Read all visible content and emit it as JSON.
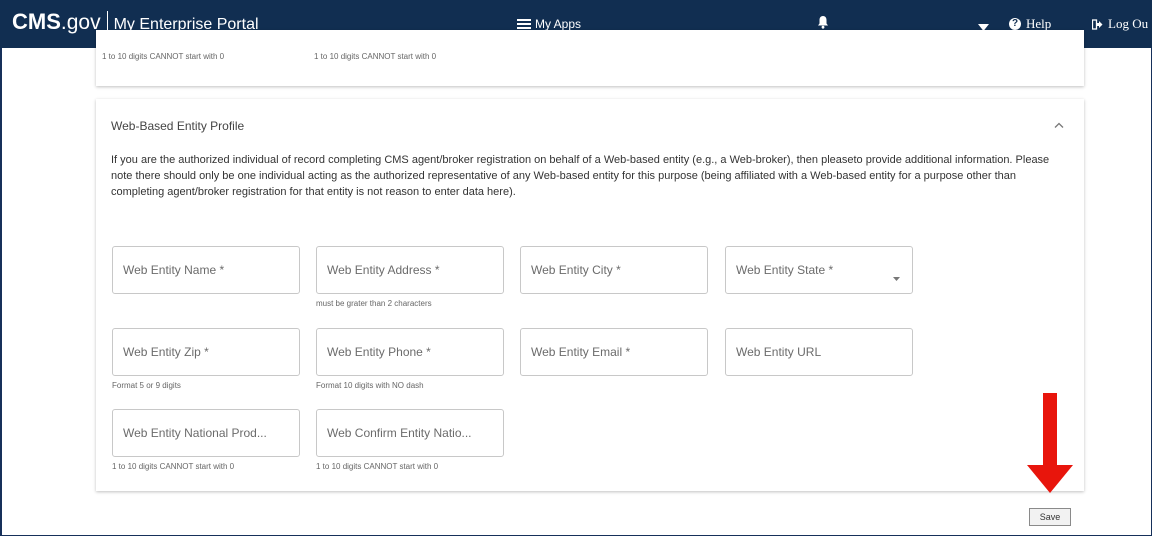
{
  "navbar": {
    "brand_cms": "CMS",
    "brand_gov": ".gov",
    "portal_title": "My Enterprise Portal",
    "apps_label": "My Apps",
    "help_label": "Help",
    "logout_label": "Log Ou"
  },
  "previous_card": {
    "hint_1": "1 to 10 digits CANNOT start with 0",
    "hint_2": "1 to 10 digits CANNOT start with 0"
  },
  "section": {
    "title": "Web-Based Entity Profile",
    "description": "If you are the authorized individual of record completing CMS agent/broker registration on behalf of a Web-based entity (e.g., a Web-broker), then pleaseto provide additional information. Please note there should only be one individual acting as the authorized representative of any Web-based entity for this purpose (being affiliated with a Web-based entity for a purpose other than completing agent/broker registration for that entity is not reason to enter data here).",
    "fields": {
      "name": {
        "placeholder": "Web Entity Name *"
      },
      "address": {
        "placeholder": "Web Entity Address *",
        "hint": "must be grater than 2 characters"
      },
      "city": {
        "placeholder": "Web Entity City *"
      },
      "state": {
        "placeholder": "Web Entity State *"
      },
      "zip": {
        "placeholder": "Web Entity Zip *",
        "hint": "Format 5 or 9 digits"
      },
      "phone": {
        "placeholder": "Web Entity Phone *",
        "hint": "Format 10 digits with NO dash"
      },
      "email": {
        "placeholder": "Web Entity Email *"
      },
      "url": {
        "placeholder": "Web Entity URL"
      },
      "npn": {
        "placeholder": "Web Entity National Prod...",
        "hint": "1 to 10 digits CANNOT start with 0"
      },
      "confirm_npn": {
        "placeholder": "Web Confirm Entity Natio...",
        "hint": "1 to 10 digits CANNOT start with 0"
      }
    }
  },
  "actions": {
    "save_label": "Save"
  },
  "colors": {
    "navbar": "#112e51",
    "annotation_arrow": "#e8150c"
  }
}
